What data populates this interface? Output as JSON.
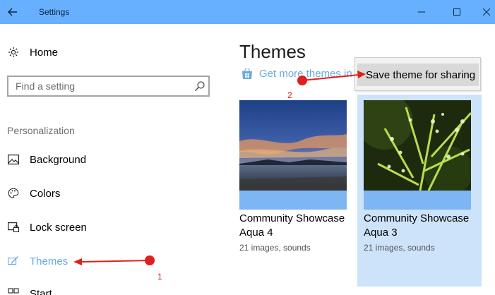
{
  "window": {
    "title": "Settings",
    "back_icon": "back-arrow-icon",
    "controls": {
      "minimize_icon": "minimize-icon",
      "maximize_icon": "maximize-icon",
      "close_icon": "close-icon"
    },
    "titlebar_color": "#67b0ff"
  },
  "sidebar": {
    "home_label": "Home",
    "search_placeholder": "Find a setting",
    "section_label": "Personalization",
    "items": [
      {
        "label": "Background",
        "icon": "picture-icon"
      },
      {
        "label": "Colors",
        "icon": "palette-icon"
      },
      {
        "label": "Lock screen",
        "icon": "lock-screen-icon"
      },
      {
        "label": "Themes",
        "icon": "themes-brush-icon",
        "active": true
      },
      {
        "label": "Start",
        "icon": "start-icon"
      }
    ],
    "active_color": "#67a7e6"
  },
  "main": {
    "title": "Themes",
    "store_link": "Get more themes in",
    "context_menu": {
      "item": "Save theme for sharing"
    },
    "themes": [
      {
        "name": "Community Showcase Aqua 4",
        "subtitle": "21 images, sounds",
        "selected": false
      },
      {
        "name": "Community Showcase Aqua 3",
        "subtitle": "21 images, sounds",
        "selected": true
      }
    ],
    "selection_color": "#cce3fa"
  },
  "annotations": {
    "step_1": "1",
    "step_2": "2",
    "arrow_color": "#e0201b"
  }
}
